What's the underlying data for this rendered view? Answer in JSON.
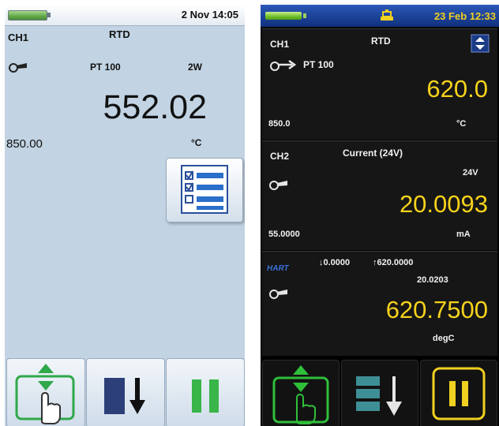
{
  "left_screen": {
    "date_time": "2 Nov  14:05",
    "channel": "CH1",
    "function": "RTD",
    "sensor": "PT 100",
    "wiring": "2W",
    "reading": "552.02",
    "range": "850.00",
    "unit": "°C",
    "icons": [
      "battery-icon",
      "probe-icon",
      "menu-list-icon",
      "up-down-hand-icon",
      "step-down-icon",
      "pause-icon"
    ]
  },
  "right_screen": {
    "date_time": "23 Feb  12:33",
    "ch1": {
      "channel": "CH1",
      "function": "RTD",
      "sensor": "PT 100",
      "reading": "620.0",
      "range": "850.0",
      "unit": "°C"
    },
    "ch2": {
      "channel": "CH2",
      "function": "Current (24V)",
      "loop_power": "24V",
      "reading": "20.0093",
      "range": "55.0000",
      "unit": "mA"
    },
    "hart": {
      "label": "HART",
      "range_low": "↓0.0000",
      "range_high": "↑620.0000",
      "secondary": "20.0203",
      "reading": "620.7500",
      "unit": "degC"
    },
    "colors": {
      "accent_yellow": "#f5d21c",
      "green": "#2fbf3a",
      "status_blue": "#1c3f98"
    },
    "icons": [
      "battery-icon",
      "usb-icon",
      "up-down-arrow-icon",
      "probe-icon",
      "up-down-hand-icon",
      "step-down-icon",
      "pause-icon"
    ]
  }
}
